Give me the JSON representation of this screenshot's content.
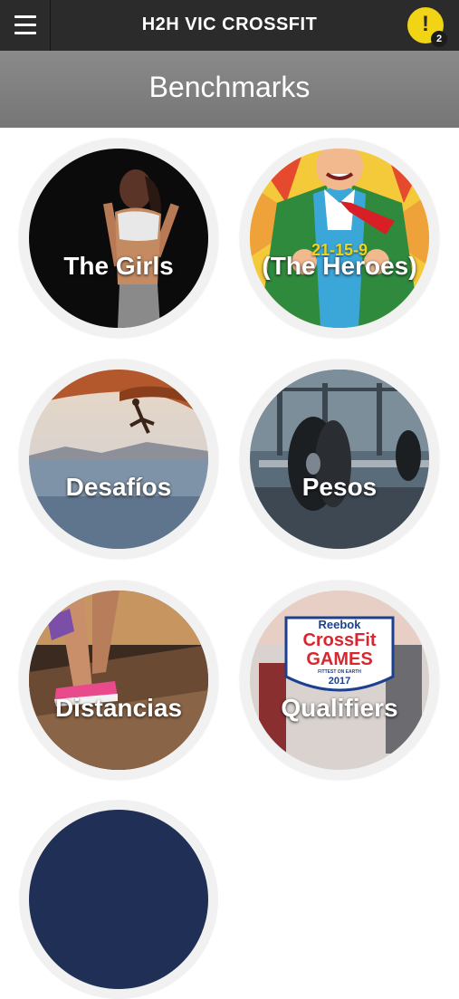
{
  "header": {
    "title": "H2H VIC CROSSFIT",
    "menu_icon": "hamburger-menu-icon",
    "alert_icon": "exclamation-icon",
    "alert_mark": "!",
    "alert_count": "2",
    "accent": "#f2d417"
  },
  "subheader": {
    "title": "Benchmarks"
  },
  "categories": [
    {
      "label": "The Girls"
    },
    {
      "label": "(The Heroes)",
      "badge_text": "21-15-9"
    },
    {
      "label": "Desafíos"
    },
    {
      "label": "Pesos"
    },
    {
      "label": "Distancias"
    },
    {
      "label": "Qualifiers",
      "logo": {
        "brand": "Reebok",
        "line1": "CrossFit",
        "line2": "GAMES",
        "tagline": "FITTEST ON EARTH",
        "year": "2017"
      }
    }
  ]
}
